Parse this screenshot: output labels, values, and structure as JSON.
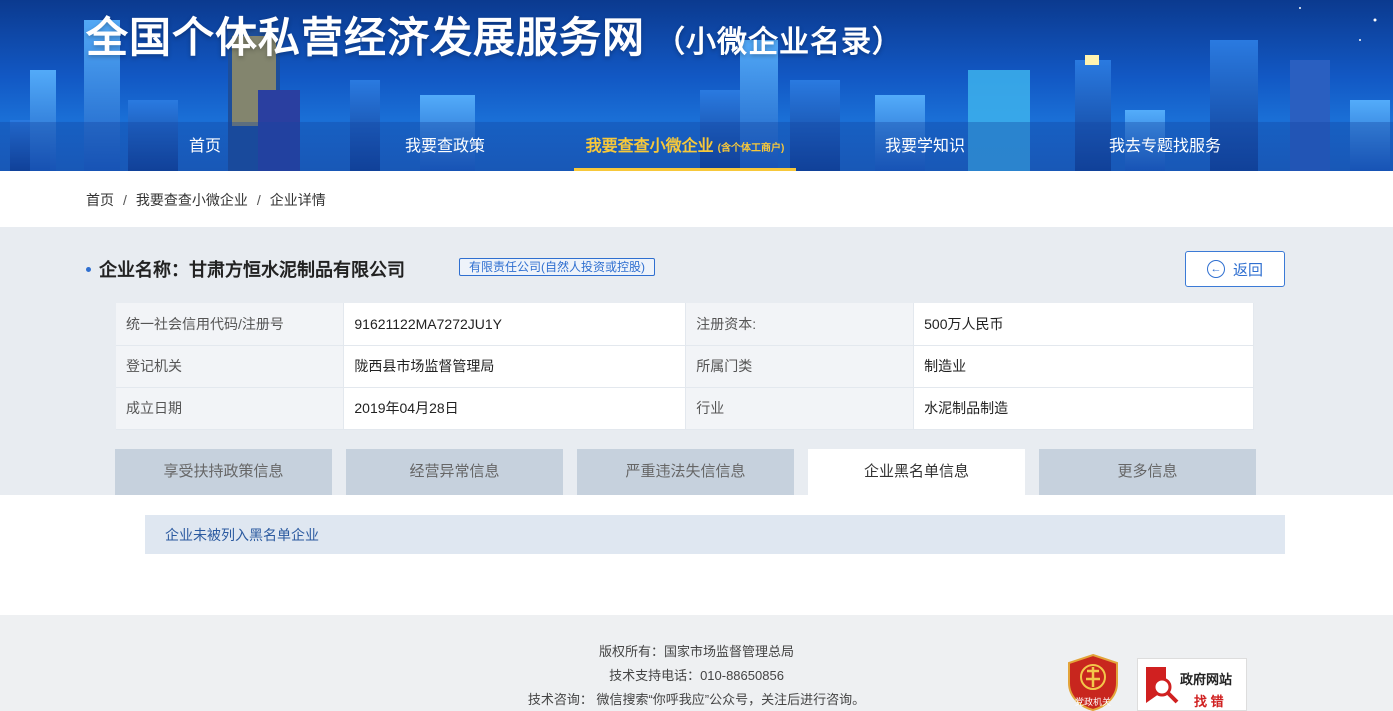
{
  "header": {
    "title": "全国个体私营经济发展服务网",
    "subtitle": "（小微企业名录）"
  },
  "nav": {
    "items": [
      {
        "label": "首页"
      },
      {
        "label": "我要查政策"
      },
      {
        "label": "我要查查小微企业",
        "note": "(含个体工商户)"
      },
      {
        "label": "我要学知识"
      },
      {
        "label": "我去专题找服务"
      }
    ]
  },
  "breadcrumb": {
    "items": [
      "首页",
      "我要查查小微企业",
      "企业详情"
    ],
    "separator": "/"
  },
  "company": {
    "name_label": "企业名称：",
    "name": "甘肃方恒水泥制品有限公司",
    "type_tag": "有限责任公司(自然人投资或控股)",
    "back_label": "返回"
  },
  "info": {
    "rows": [
      {
        "label1": "统一社会信用代码/注册号",
        "value1": "91621122MA7272JU1Y",
        "label2": "注册资本:",
        "value2": "500万人民币"
      },
      {
        "label1": "登记机关",
        "value1": "陇西县市场监督管理局",
        "label2": "所属门类",
        "value2": "制造业"
      },
      {
        "label1": "成立日期",
        "value1": "2019年04月28日",
        "label2": "行业",
        "value2": "水泥制品制造"
      }
    ]
  },
  "tabs": [
    {
      "label": "享受扶持政策信息"
    },
    {
      "label": "经营异常信息"
    },
    {
      "label": "严重违法失信信息"
    },
    {
      "label": "企业黑名单信息",
      "active": true
    },
    {
      "label": "更多信息"
    }
  ],
  "result": {
    "text": "企业未被列入黑名单企业"
  },
  "footer": {
    "copyright": "版权所有：国家市场监督管理总局",
    "phone": "技术支持电话：010-88650856",
    "consult": "技术咨询：  微信搜索“你呼我应”公众号，关注后进行咨询。",
    "badge1_text": "党政机关",
    "badge2_line1": "政府网站",
    "badge2_line2": "找 错"
  },
  "colors": {
    "accent": "#2f6fd0",
    "nav_active": "#f7c83a",
    "header_blue": "#1258c4",
    "badge_red": "#d02020"
  }
}
